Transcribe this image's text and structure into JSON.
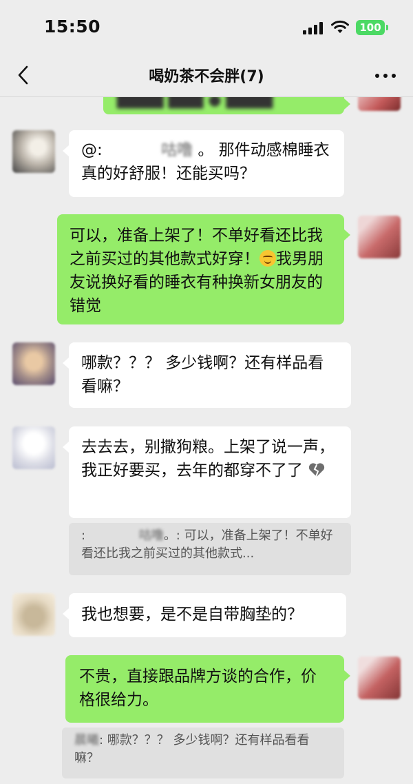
{
  "status_bar": {
    "time": "15:50",
    "battery": "100"
  },
  "header": {
    "title": "喝奶茶不会胖(7)"
  },
  "messages": [
    {
      "type": "in",
      "mention": "@:",
      "name_hint": "咕噜",
      "text": "。 那件动感棉睡衣真的好舒服！还能买吗？"
    },
    {
      "type": "out",
      "text1": "可以，准备上架了！不单好看还比我之前买过的其他款式好穿！",
      "text2": "我男朋友说换好看的睡衣有种换新女朋友的错觉"
    },
    {
      "type": "in",
      "text": "哪款？？？ 多少钱啊？还有样品看看嘛？"
    },
    {
      "type": "in",
      "text": "去去去，别撒狗粮。上架了说一声，我正好要买，去年的都穿不了了"
    },
    {
      "type": "quote",
      "prefix": ":",
      "name_hint": "咕噜",
      "text": "。: 可以，准备上架了！不单好看还比我之前买过的其他款式..."
    },
    {
      "type": "in",
      "text": "我也想要，是不是自带胸垫的？"
    },
    {
      "type": "out",
      "text": "不贵，直接跟品牌方谈的合作，价格很给力。"
    },
    {
      "type": "quote",
      "name_hint": "晨曦",
      "text": ": 哪款？？？ 多少钱啊？还有样品看看嘛？"
    }
  ],
  "colors": {
    "background": "#ededed",
    "out_bubble": "#95ec69",
    "in_bubble": "#ffffff",
    "battery": "#4cd964"
  }
}
